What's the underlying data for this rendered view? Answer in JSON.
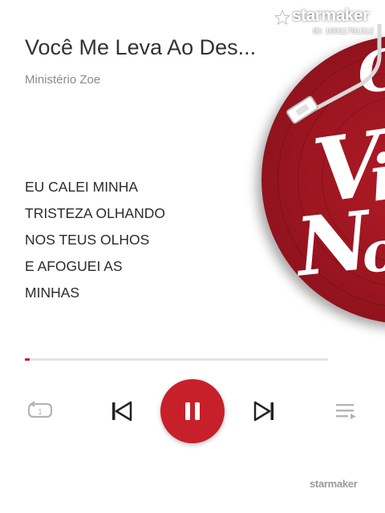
{
  "watermark": {
    "logo": "starmaker",
    "id": "ID: 10011791312"
  },
  "song": {
    "title": "Você Me Leva Ao Des...",
    "artist": "Ministério Zoe"
  },
  "lyrics": [
    "EU CALEI MINHA",
    "TRISTEZA OLHANDO",
    "NOS TEUS OLHOS",
    "E AFOGUEI AS",
    "MINHAS"
  ],
  "playback": {
    "state": "playing",
    "progress": 0.015
  },
  "colors": {
    "accent": "#c8202a",
    "record": "#9a1520",
    "icon_gray": "#b4b4b4",
    "icon_dark": "#222222"
  },
  "icons": {
    "repeat": "repeat-one-icon",
    "previous": "skip-previous-icon",
    "pause": "pause-icon",
    "next": "skip-next-icon",
    "playlist": "playlist-icon"
  },
  "footer": {
    "brand": "starmaker"
  }
}
